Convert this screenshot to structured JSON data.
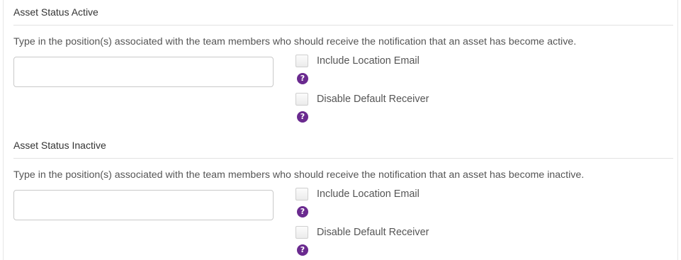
{
  "sections": [
    {
      "title": "Asset Status Active",
      "description": "Type in the position(s) associated with the team members who should receive the notification that an asset has become active.",
      "input_value": "",
      "options": [
        {
          "label": "Include Location Email",
          "checked": false,
          "help_icon": "question-circle-icon"
        },
        {
          "label": "Disable Default Receiver",
          "checked": false,
          "help_icon": "question-circle-icon"
        }
      ]
    },
    {
      "title": "Asset Status Inactive",
      "description": "Type in the position(s) associated with the team members who should receive the notification that an asset has become inactive.",
      "input_value": "",
      "options": [
        {
          "label": "Include Location Email",
          "checked": false,
          "help_icon": "question-circle-icon"
        },
        {
          "label": "Disable Default Receiver",
          "checked": false,
          "help_icon": "question-circle-icon"
        }
      ]
    }
  ],
  "colors": {
    "help_icon": "#6a2a8f",
    "divider": "#e2e2e2",
    "text": "#555555"
  }
}
